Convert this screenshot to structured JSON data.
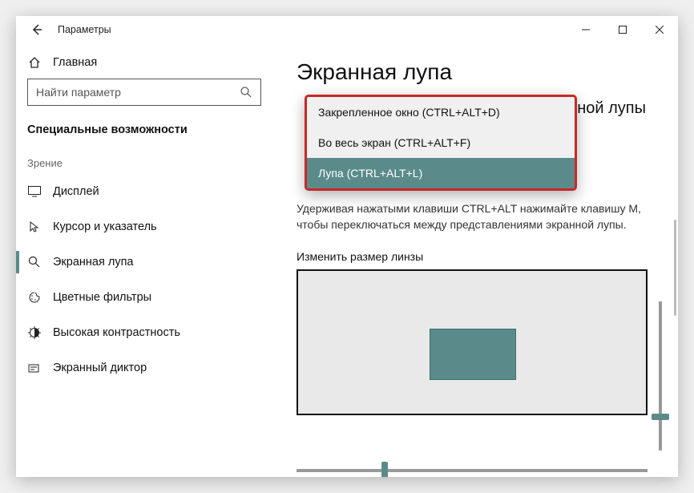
{
  "window": {
    "title": "Параметры"
  },
  "sidebar": {
    "home": "Главная",
    "search_placeholder": "Найти параметр",
    "category": "Специальные возможности",
    "group": "Зрение",
    "items": [
      {
        "label": "Дисплей"
      },
      {
        "label": "Курсор и указатель"
      },
      {
        "label": "Экранная лупа"
      },
      {
        "label": "Цветные фильтры"
      },
      {
        "label": "Высокая контрастность"
      },
      {
        "label": "Экранный диктор"
      }
    ]
  },
  "main": {
    "page_title": "Экранная лупа",
    "subtitle_visible_fragment": "нной лупы",
    "hint": "Удерживая нажатыми клавиши CTRL+ALT нажимайте клавишу M, чтобы переключаться между представлениями экранной лупы.",
    "lens_label": "Изменить размер линзы"
  },
  "dropdown": {
    "options": [
      "Закрепленное окно (CTRL+ALT+D)",
      "Во весь экран (CTRL+ALT+F)",
      "Лупа (CTRL+ALT+L)"
    ],
    "selected_index": 2
  }
}
